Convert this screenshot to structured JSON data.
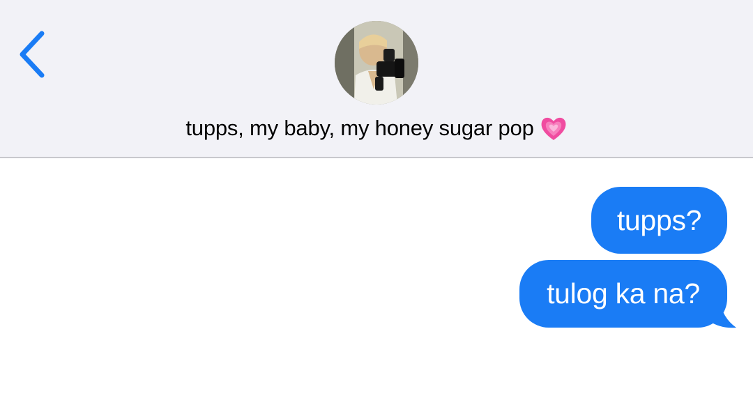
{
  "header": {
    "contact_name": "tupps, my baby, my honey sugar pop",
    "status_emoji": "growing-heart-icon"
  },
  "colors": {
    "accent": "#1a7cf5",
    "header_bg": "#f2f2f7",
    "divider": "#c8c8cd",
    "heart": "#f04ca0"
  },
  "messages": [
    {
      "text": "tupps?",
      "direction": "outgoing"
    },
    {
      "text": "tulog ka na?",
      "direction": "outgoing"
    }
  ]
}
